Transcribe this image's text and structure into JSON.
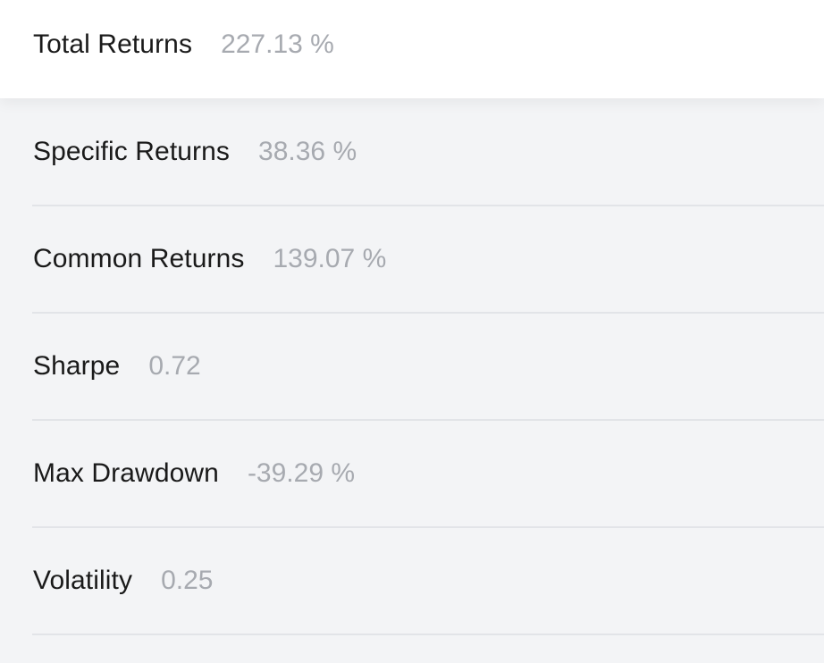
{
  "header": {
    "label": "Total Returns",
    "value": "227.13 %"
  },
  "metrics": [
    {
      "label": "Specific Returns",
      "value": "38.36 %"
    },
    {
      "label": "Common Returns",
      "value": "139.07 %"
    },
    {
      "label": "Sharpe",
      "value": "0.72"
    },
    {
      "label": "Max Drawdown",
      "value": "-39.29 %"
    },
    {
      "label": "Volatility",
      "value": "0.25"
    }
  ]
}
